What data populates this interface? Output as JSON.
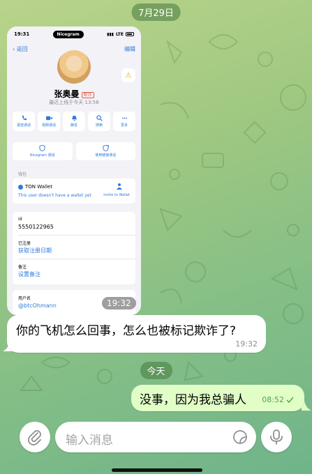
{
  "date_pills": {
    "top": "7月29日",
    "today": "今天"
  },
  "screenshot": {
    "status_time": "19:31",
    "island_label": "Nicegram",
    "status_network": "LTE",
    "nav_back": "返回",
    "nav_edit": "编辑",
    "profile_name": "张奥曼",
    "scam_badge": "欺诈",
    "last_seen": "最近上线于今天 13:56",
    "actions": [
      {
        "label": "语音通话",
        "icon": "phone-icon"
      },
      {
        "label": "视频通话",
        "icon": "video-icon"
      },
      {
        "label": "静音",
        "icon": "bell-icon"
      },
      {
        "label": "搜索",
        "icon": "search-icon"
      },
      {
        "label": "更多",
        "icon": "more-icon"
      }
    ],
    "actions2": [
      {
        "label": "Nicegram 通话",
        "icon": "phone-shield-icon"
      },
      {
        "label": "使用链接通话",
        "icon": "phone-link-icon"
      }
    ],
    "wallet_section": "钱包",
    "wallet_title": "TON Wallet",
    "wallet_sub": "This user doesn't have a wallet yet",
    "wallet_invite": "Invite to Wallet",
    "id_label": "id",
    "id_value": "5550122965",
    "registered_label": "已注册",
    "registered_value": "获取注册日期",
    "notes_label": "备注",
    "notes_value": "设置备注",
    "username_label": "用户名",
    "username_value": "@btcOhmann",
    "message_time": "19:32"
  },
  "incoming": {
    "text": "你的飞机怎么回事，怎么也被标记欺诈了?",
    "time": "19:32"
  },
  "outgoing": {
    "text": "没事，因为我总骗人",
    "time": "08:52",
    "status": "read"
  },
  "composer": {
    "placeholder": "输入消息"
  },
  "colors": {
    "accent": "#2f7ad9",
    "outgoing_bubble": "#e1fec6",
    "read_check": "#4fa64c"
  }
}
